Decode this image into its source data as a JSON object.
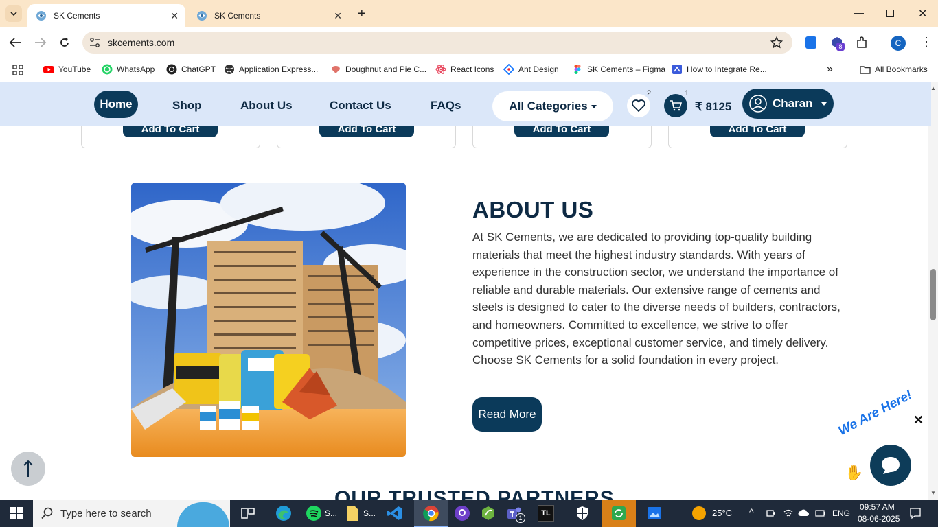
{
  "browser": {
    "tabs": [
      {
        "title": "SK Cements",
        "active": true
      },
      {
        "title": "SK Cements",
        "active": false
      }
    ],
    "url": "skcements.com",
    "bookmarks": [
      {
        "label": "YouTube",
        "icon": "youtube-icon",
        "color": "#ff0000"
      },
      {
        "label": "WhatsApp",
        "icon": "whatsapp-icon",
        "color": "#25d366"
      },
      {
        "label": "ChatGPT",
        "icon": "chatgpt-icon",
        "color": "#222222"
      },
      {
        "label": "Application Express...",
        "icon": "globe-icon",
        "color": "#333333"
      },
      {
        "label": "Doughnut and Pie C...",
        "icon": "chart-icon",
        "color": "#e0736a"
      },
      {
        "label": "React Icons",
        "icon": "react-icon",
        "color": "#e8455c"
      },
      {
        "label": "Ant Design",
        "icon": "ant-design-icon",
        "color": "#1677ff"
      },
      {
        "label": "SK Cements – Figma",
        "icon": "figma-icon",
        "color": "#f24e1e"
      },
      {
        "label": "How to Integrate Re...",
        "icon": "bookmark-page-icon",
        "color": "#3b5bdb"
      }
    ],
    "all_bookmarks": "All Bookmarks",
    "profile_initial": "C",
    "extension_badge": "8"
  },
  "nav": {
    "home": "Home",
    "shop": "Shop",
    "about": "About Us",
    "contact": "Contact Us",
    "faqs": "FAQs",
    "categories": "All Categories",
    "wishlist_count": "2",
    "cart_count": "1",
    "cart_total": "₹ 8125",
    "user": "Charan"
  },
  "products": {
    "add_to_cart": "Add To Cart"
  },
  "about": {
    "title": "ABOUT US",
    "text": "At SK Cements, we are dedicated to providing top-quality building materials that meet the highest industry standards. With years of experience in the construction sector, we understand the importance of reliable and durable materials. Our extensive range of cements and steels is designed to cater to the diverse needs of builders, contractors, and homeowners. Committed to excellence, we strive to offer competitive prices, exceptional customer service, and timely delivery. Choose SK Cements for a solid foundation in every project.",
    "read_more": "Read More"
  },
  "partners": {
    "title": "OUR TRUSTED PARTNERS"
  },
  "chat": {
    "tagline": "We Are Here!"
  },
  "taskbar": {
    "search_placeholder": "Type here to search",
    "app1": "S...",
    "app2": "S...",
    "teams_badge": "1",
    "weather": "25°C",
    "lang": "ENG",
    "time": "09:57 AM",
    "date": "08-06-2025"
  },
  "colors": {
    "brand": "#0b3a5a",
    "nav_bg": "#dbe7f9",
    "tab_strip": "#fbe6c9"
  }
}
